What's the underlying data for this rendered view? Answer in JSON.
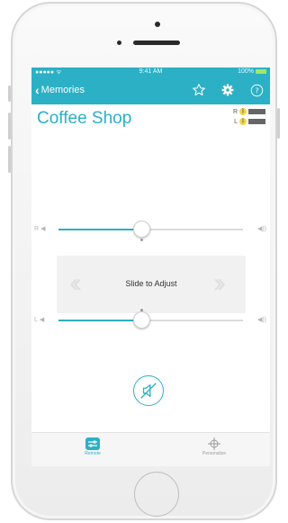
{
  "status_bar": {
    "signal": "●●●●● ᯤ",
    "time": "9:41 AM",
    "battery": "100%"
  },
  "nav": {
    "back_label": "Memories",
    "icons": [
      "star-icon",
      "gear-icon",
      "help-icon"
    ]
  },
  "program": {
    "title": "Coffee Shop",
    "right_indicator": "R",
    "left_indicator": "L"
  },
  "sliders": {
    "right": {
      "label": "R",
      "value_fraction": 0.45
    },
    "left": {
      "label": "L",
      "value_fraction": 0.45
    }
  },
  "adjust": {
    "label": "Slide to Adjust"
  },
  "mute": {
    "icon": "speaker-muted-icon"
  },
  "tabs": [
    {
      "label": "Remote",
      "icon": "remote-icon",
      "active": true
    },
    {
      "label": "Personalize",
      "icon": "crosshair-icon",
      "active": false
    }
  ],
  "colors": {
    "accent": "#2cb0c5",
    "battery": "#9fe86a",
    "bluetooth_badge": "#f0d64a"
  }
}
